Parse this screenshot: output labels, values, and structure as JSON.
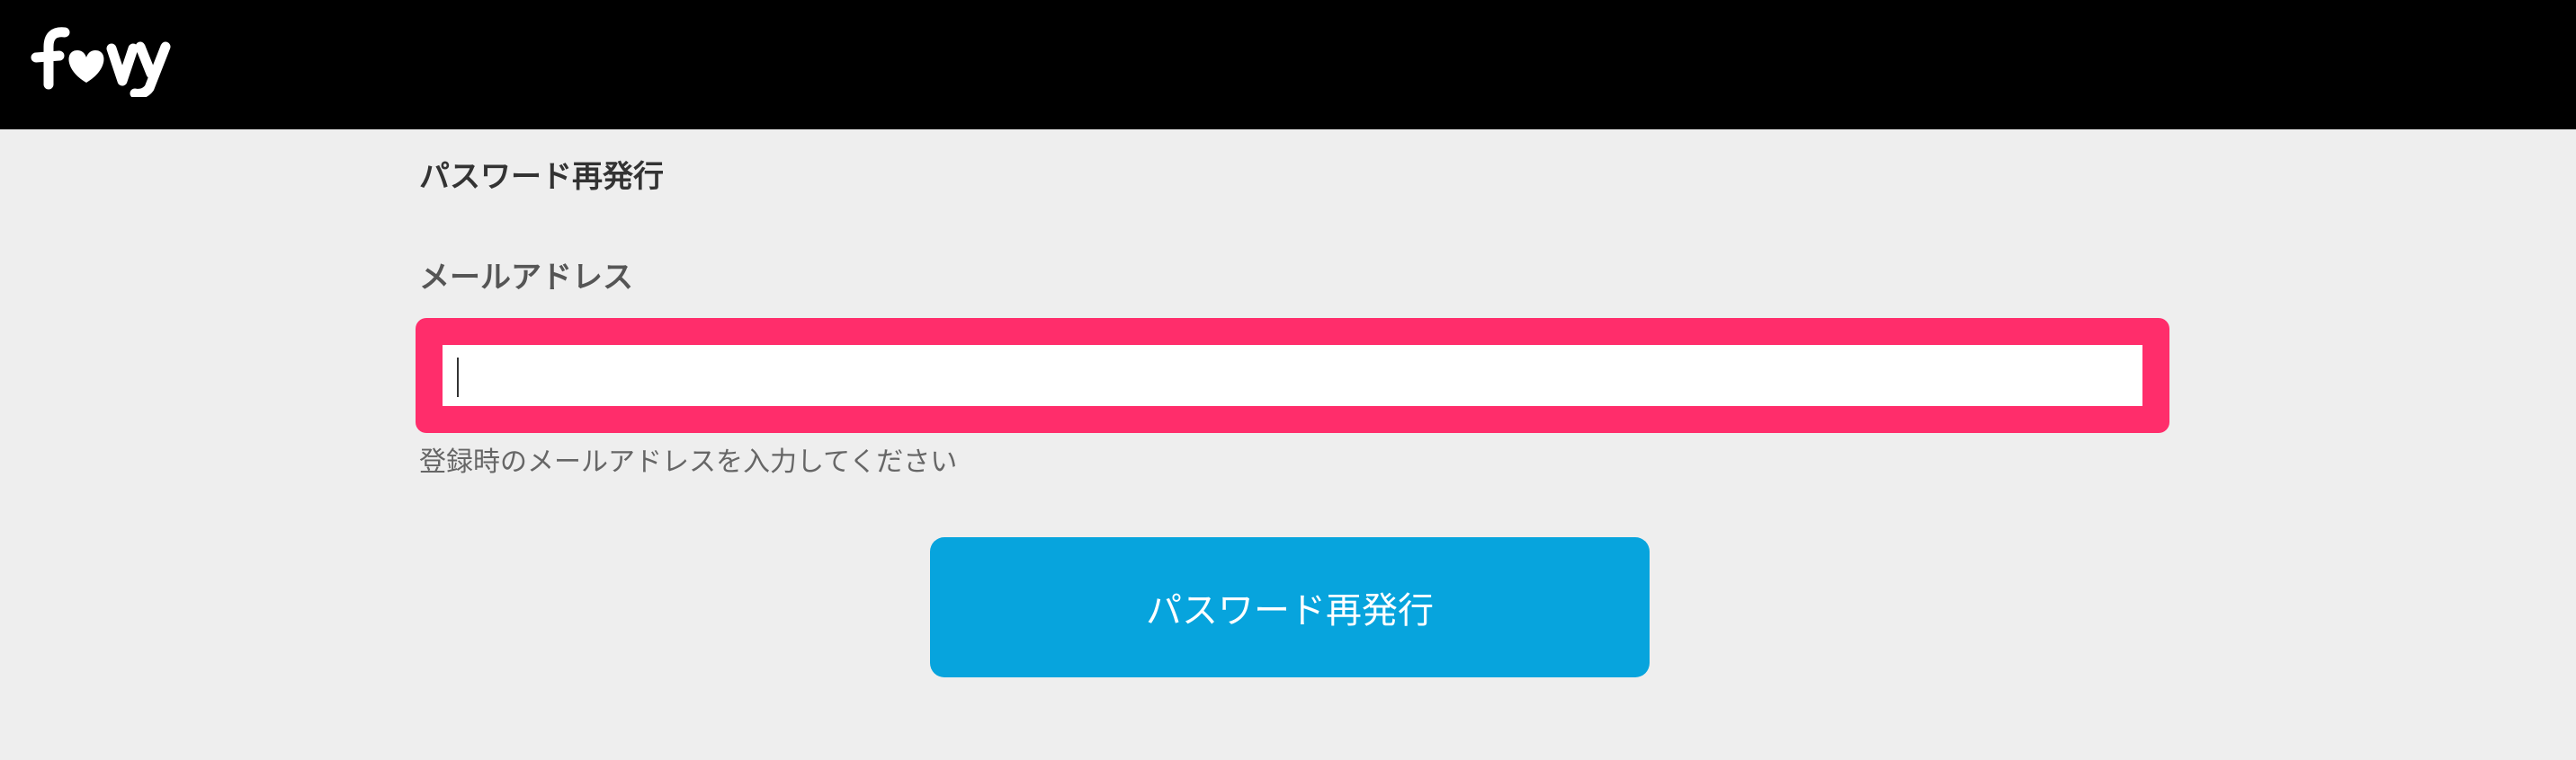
{
  "header": {
    "logo_text": "favy",
    "colors": {
      "background": "#000000",
      "logo": "#ffffff"
    }
  },
  "form": {
    "title": "パスワード再発行",
    "email_label": "メールアドレス",
    "email_value": "",
    "email_placeholder": "",
    "hint": "登録時のメールアドレスを入力してください",
    "submit_label": "パスワード再発行",
    "colors": {
      "page_background": "#eeeeee",
      "input_focus_border": "#ff2d6b",
      "submit_background": "#07a4dd",
      "submit_text": "#ffffff"
    }
  }
}
